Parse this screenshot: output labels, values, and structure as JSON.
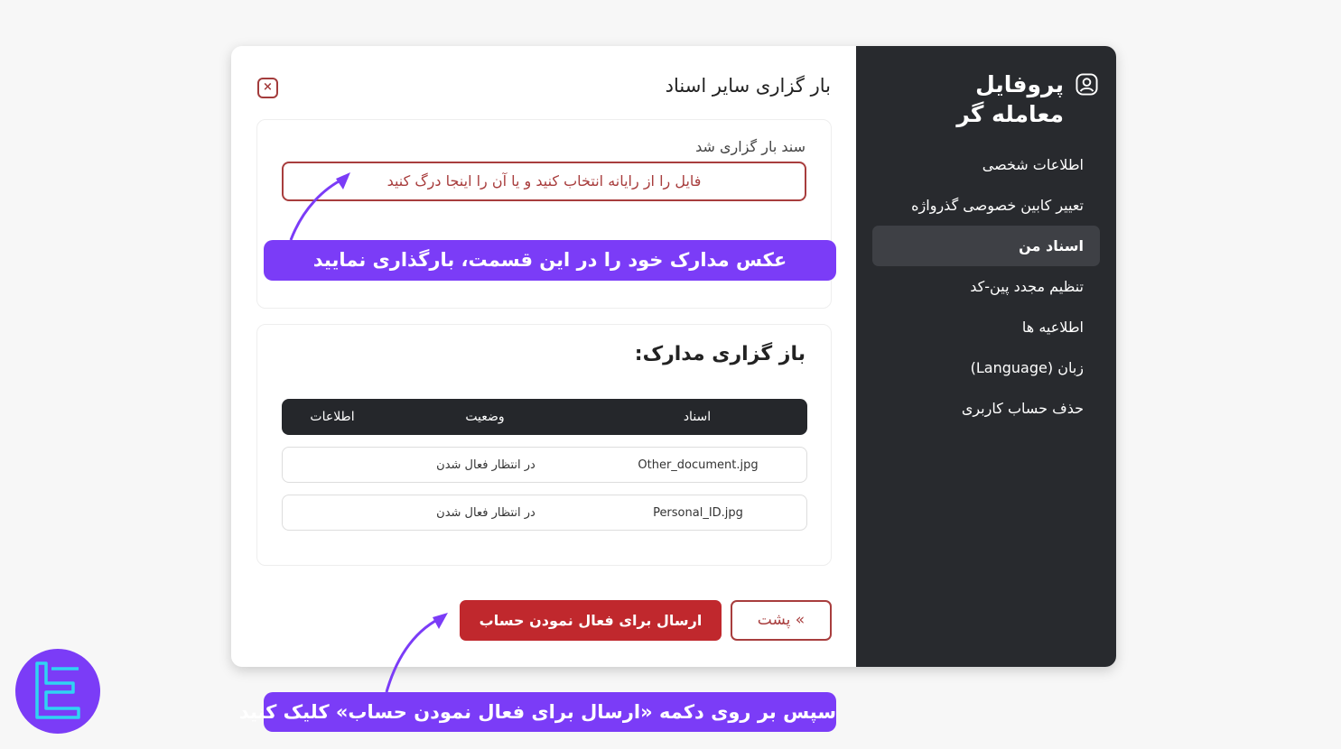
{
  "sidebar": {
    "title": "پروفایل معامله گر",
    "items": [
      {
        "label": "اطلاعات شخصی",
        "active": false
      },
      {
        "label": "تعییر کابین خصوصی گذرواژه",
        "active": false
      },
      {
        "label": "اسناد من",
        "active": true
      },
      {
        "label": "تنظیم مجدد پین-کد",
        "active": false
      },
      {
        "label": "اطلاعیه ها",
        "active": false
      },
      {
        "label": "زبان (Language)",
        "active": false
      },
      {
        "label": "حذف حساب کاربری",
        "active": false
      }
    ]
  },
  "modal": {
    "title": "بار گزاری سایر اسناد",
    "close_icon": "×",
    "upload": {
      "label": "سند بار گزاری شد",
      "dropzone_text": "فایل را از رایانه انتخاب کنید و یا آن را اینجا درگ کنید"
    },
    "documents": {
      "title": "باز گزاری مدارک:",
      "columns": [
        "اسناد",
        "وضعیت",
        "اطلاعات"
      ],
      "rows": [
        {
          "document": "Other_document.jpg",
          "status": "در انتظار فعال شدن",
          "info": ""
        },
        {
          "document": "Personal_ID.jpg",
          "status": "در انتظار فعال شدن",
          "info": ""
        }
      ]
    },
    "buttons": {
      "submit": "ارسال برای فعال نمودن حساب",
      "back": "» پشت"
    }
  },
  "annotations": {
    "upload_hint": "عکس مدارک خود را در این قسمت، بارگذاری نمایید",
    "submit_hint": "سپس بر روی دکمه «ارسال برای فعال نمودن حساب» کلیک کنید"
  },
  "colors": {
    "sidebar_bg": "#282a2e",
    "accent_red": "#c0282d",
    "annotation_purple": "#7b3cf7"
  }
}
